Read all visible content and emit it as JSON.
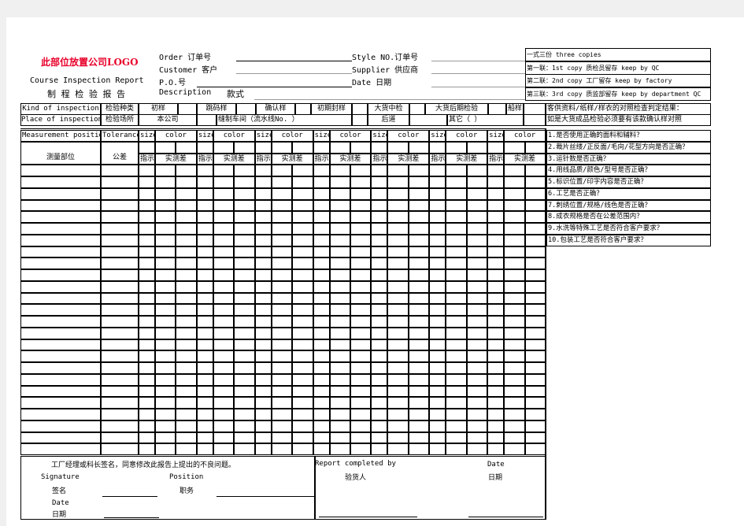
{
  "header": {
    "logo_text": "此部位放置公司LOGO",
    "title_en": "Course Inspection Report",
    "title_cn": "制 程 检 验 报 告",
    "order_label": "Order 订单号",
    "customer_label": "Customer 客户",
    "po_label": "P.O.号",
    "description_label": "Description",
    "description_cn": "款式",
    "style_label": "Style NO.订单号",
    "supplier_label": "Supplier 供应商",
    "date_label": "Date 日期"
  },
  "copies": [
    "一式三份 three copies",
    "第一联：1st copy 质检员留存 keep by QC",
    "第二联：2nd copy 工厂留存  keep by factory",
    "第三联：3rd copy 质监部留存 keep by department QC"
  ],
  "inspection": {
    "kind_label": "Kind of inspection",
    "kind_cn": "检验种类",
    "kinds": [
      "初样",
      "跳码样",
      "确认样",
      "初期封样",
      "大货中检",
      "大货后期检验",
      "船样"
    ],
    "place_label": "Place of inspection",
    "place_cn": "检验场所",
    "places": [
      "本公司",
      "缝制车间（流水线No.        ）",
      "后道",
      "其它（          ）"
    ],
    "note_1": "客供资料/纸样/样衣的对照检查判定结果：",
    "note_2": "如是大货成品检验必须要有该款确认样对照"
  },
  "grid": {
    "measurement_label": "Measurement position",
    "measurement_cn": "测量部位",
    "tolerance_label": "Tolerance",
    "tolerance_cn": "公差",
    "size_label": "size",
    "color_label": "color",
    "indicator_cn": "指示",
    "deviation_cn": "实测差"
  },
  "checklist": [
    "1.是否使用正确的面料和辅料？",
    "2.裁片丝缕/正反面/毛向/花型方向是否正确？",
    "3.运针数是否正确？",
    "4.用线品质/颜色/型号是否正确？",
    "5.标识位置/印字内容是否正确？",
    "6.工艺是否正确？",
    "7.刺绣位置/规格/线色是否正确？",
    "8.成衣规格是否在公差范围内？",
    "9.水洗等特殊工艺是否符合客户要求？",
    "10.包装工艺是否符合客户要求？"
  ],
  "footer": {
    "agreement": "工厂经理或科长签名，同意修改此报告上提出的不良问题。",
    "signature_label": "Signature",
    "signature_cn": "签名",
    "position_label": "Position",
    "position_cn": "职务",
    "date_label": "Date",
    "date_cn": "日期",
    "report_by_label": "Report completed by",
    "report_by_cn": "验货人",
    "report_date_label": "Date",
    "report_date_cn": "日期"
  },
  "colors": {
    "logo": "#e8002a",
    "background": "#f0f0f0"
  }
}
